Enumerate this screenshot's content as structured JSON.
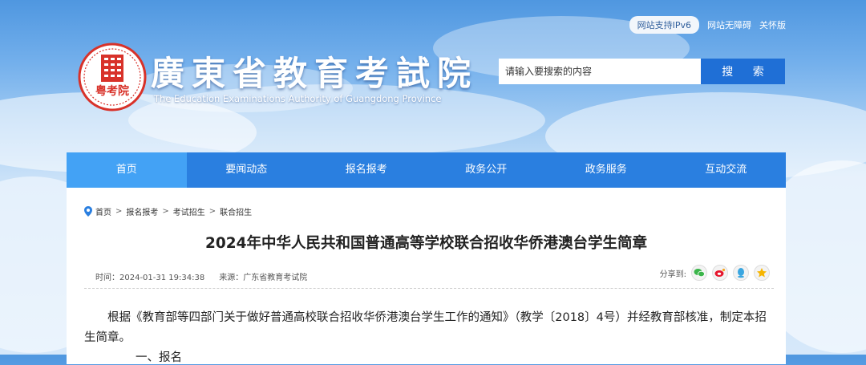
{
  "header": {
    "links": [
      "网站支持IPv6",
      "网站无障碍",
      "关怀版"
    ],
    "logo_seal_text": "粤考院",
    "logo_cn": "廣東省教育考試院",
    "logo_en": "The Education Examinations Authority of Guangdong Province"
  },
  "search": {
    "placeholder": "请输入要搜索的内容",
    "button": "搜 索"
  },
  "nav": {
    "items": [
      "首页",
      "要闻动态",
      "报名报考",
      "政务公开",
      "政务服务",
      "互动交流"
    ],
    "active": "首页"
  },
  "breadcrumb": [
    "首页",
    "报名报考",
    "考试招生",
    "联合招生"
  ],
  "article": {
    "title": "2024年中华人民共和国普通高等学校联合招收华侨港澳台学生简章",
    "time": "时间：2024-01-31 19:34:38",
    "source": "来源：广东省教育考试院",
    "share_label": "分享到:",
    "share_icons": [
      "wechat-icon",
      "weibo-icon",
      "qq-icon",
      "qzone-icon"
    ],
    "paragraph": "根据《教育部等四部门关于做好普通高校联合招收华侨港澳台学生工作的通知》（教学〔2018〕4号）并经教育部核准，制定本招生简章。",
    "next_line": "一、报名"
  },
  "colors": {
    "nav": "#2a7fe0",
    "nav_active": "#43a2f5",
    "search_button": "#1f6fd6",
    "seal": "#d8322a"
  }
}
